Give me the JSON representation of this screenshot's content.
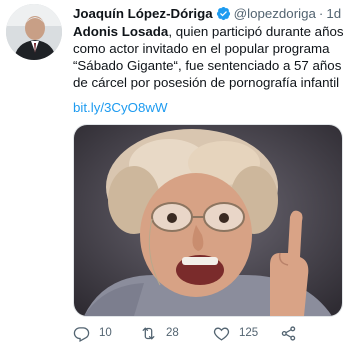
{
  "tweet": {
    "author_name": "Joaquín López-Dóriga",
    "handle": "@lopezdoriga",
    "separator": "·",
    "time": "1d",
    "text_bold": "Adonis Losada",
    "text_rest": ", quien participó durante años como actor invitado en el popular programa “Sábado Gigante“, fue sentenciado a 57 años de cárcel por posesión de pornografía infantil",
    "link": "bit.ly/3CyO8wW",
    "more_glyph": "···"
  },
  "actions": {
    "reply_count": "10",
    "retweet_count": "28",
    "like_count": "125"
  },
  "colors": {
    "link": "#1d9bf0",
    "verified": "#1d9bf0",
    "muted": "#536471"
  }
}
